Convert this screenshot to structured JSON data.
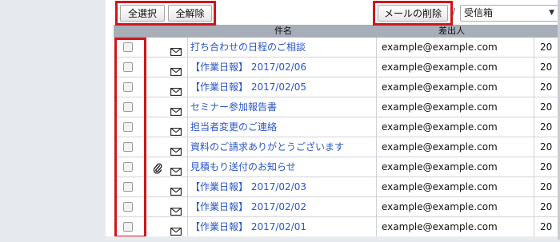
{
  "toolbar": {
    "select_all": "全選択",
    "deselect_all": "全解除",
    "delete_mail": "メールの削除",
    "separator": "/",
    "folder_selected": "受信箱"
  },
  "table": {
    "headers": {
      "subject": "件名",
      "from": "差出人"
    },
    "rows": [
      {
        "subject": "打ち合わせの日程のご相談",
        "from": "example@example.com",
        "date": "20",
        "attachment": false
      },
      {
        "subject": "【作業日報】 2017/02/06",
        "from": "example@example.com",
        "date": "20",
        "attachment": false
      },
      {
        "subject": "【作業日報】 2017/02/05",
        "from": "example@example.com",
        "date": "20",
        "attachment": false
      },
      {
        "subject": "セミナー参加報告書",
        "from": "example@example.com",
        "date": "20",
        "attachment": false
      },
      {
        "subject": "担当者変更のご連絡",
        "from": "example@example.com",
        "date": "20",
        "attachment": false
      },
      {
        "subject": "資料のご請求ありがとうございます",
        "from": "example@example.com",
        "date": "20",
        "attachment": false
      },
      {
        "subject": "見積もり送付のお知らせ",
        "from": "example@example.com",
        "date": "20",
        "attachment": true
      },
      {
        "subject": "【作業日報】 2017/02/03",
        "from": "example@example.com",
        "date": "20",
        "attachment": false
      },
      {
        "subject": "【作業日報】 2017/02/02",
        "from": "example@example.com",
        "date": "20",
        "attachment": false
      },
      {
        "subject": "【作業日報】 2017/02/01",
        "from": "example@example.com",
        "date": "20",
        "attachment": false
      }
    ]
  },
  "colors": {
    "highlight": "#d0151c",
    "header_bg": "#a7aeb7",
    "link": "#2a56c6"
  },
  "icons": {
    "mail": "envelope-icon",
    "attachment": "paperclip-icon"
  }
}
